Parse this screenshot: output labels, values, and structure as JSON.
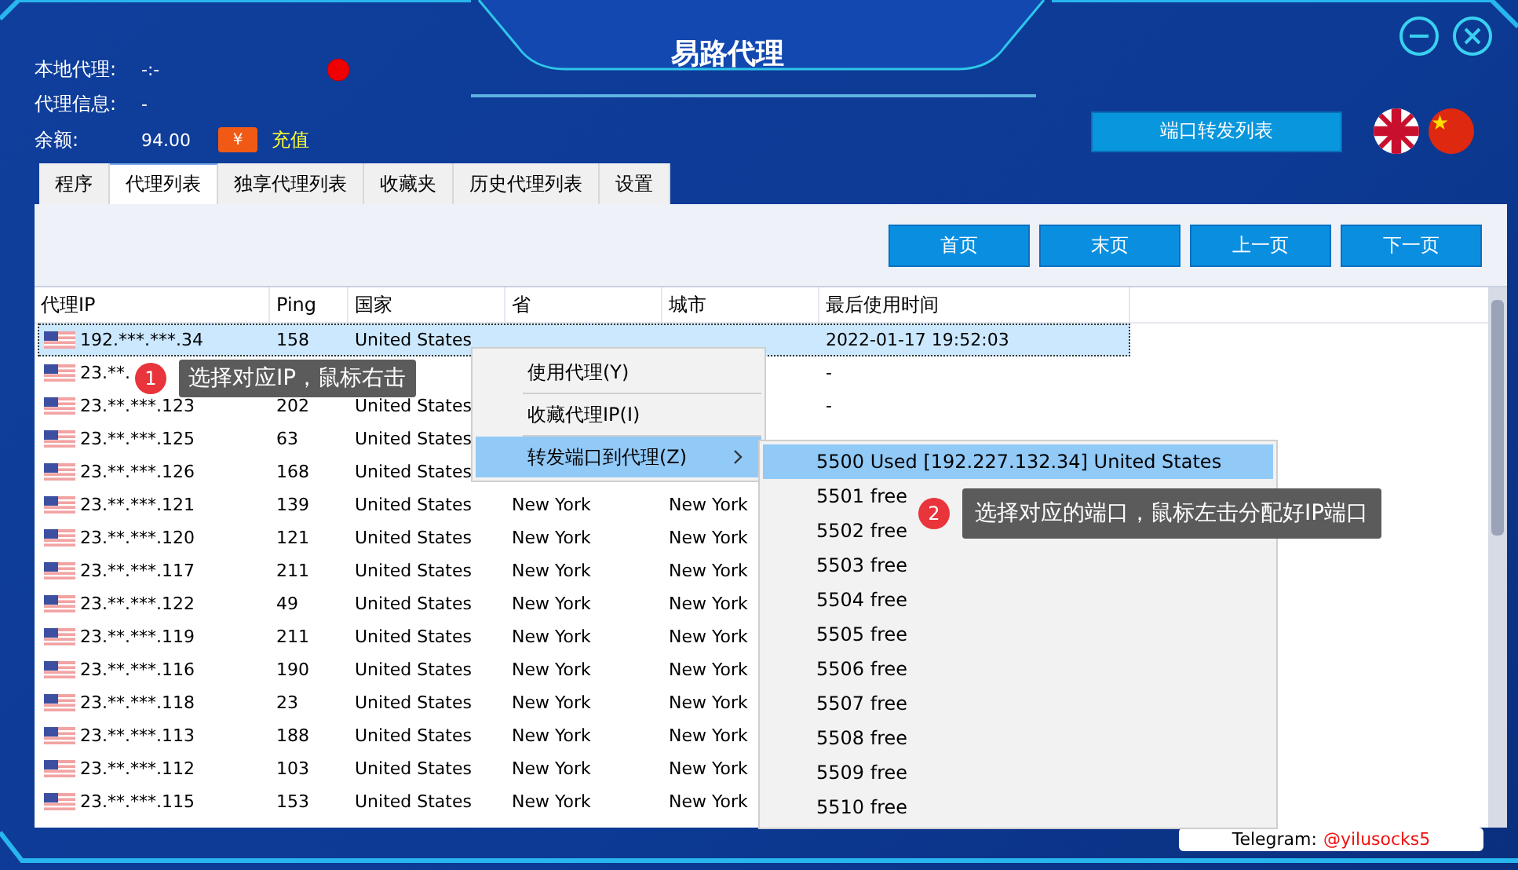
{
  "window": {
    "title": "易路代理"
  },
  "info": [
    {
      "label": "本地代理:",
      "value": "-:-"
    },
    {
      "label": "代理信息:",
      "value": "-"
    },
    {
      "label": "余额:",
      "value": "94.00"
    }
  ],
  "recharge": {
    "icon_text": "¥",
    "label": "充值"
  },
  "port_forward_button": "端口转发列表",
  "tabs": [
    {
      "label": "程序",
      "selected": false
    },
    {
      "label": "代理列表",
      "selected": true
    },
    {
      "label": "独享代理列表",
      "selected": false
    },
    {
      "label": "收藏夹",
      "selected": false
    },
    {
      "label": "历史代理列表",
      "selected": false
    },
    {
      "label": "设置",
      "selected": false
    }
  ],
  "pager": [
    "首页",
    "末页",
    "上一页",
    "下一页"
  ],
  "table": {
    "columns": [
      "代理IP",
      "Ping",
      "国家",
      "省",
      "城市",
      "最后使用时间"
    ],
    "rows": [
      {
        "ip": "192.***.***.34",
        "ping": "158",
        "country": "United States",
        "last_used": "2022-01-17 19:52:03",
        "selected": true
      },
      {
        "ip": "23.**.",
        "last_used": "-",
        "selected": false
      },
      {
        "ip": "23.**.***.123",
        "ping": "202",
        "country": "United States",
        "last_used": "-",
        "selected": false
      },
      {
        "ip": "23.**.***.125",
        "ping": "63",
        "country": "United States",
        "selected": false
      },
      {
        "ip": "23.**.***.126",
        "ping": "168",
        "country": "United States",
        "selected": false
      },
      {
        "ip": "23.**.***.121",
        "ping": "139",
        "country": "United States",
        "province": "New York",
        "city": "New York",
        "selected": false
      },
      {
        "ip": "23.**.***.120",
        "ping": "121",
        "country": "United States",
        "province": "New York",
        "city": "New York",
        "selected": false
      },
      {
        "ip": "23.**.***.117",
        "ping": "211",
        "country": "United States",
        "province": "New York",
        "city": "New York",
        "selected": false
      },
      {
        "ip": "23.**.***.122",
        "ping": "49",
        "country": "United States",
        "province": "New York",
        "city": "New York",
        "selected": false
      },
      {
        "ip": "23.**.***.119",
        "ping": "211",
        "country": "United States",
        "province": "New York",
        "city": "New York",
        "selected": false
      },
      {
        "ip": "23.**.***.116",
        "ping": "190",
        "country": "United States",
        "province": "New York",
        "city": "New York",
        "selected": false
      },
      {
        "ip": "23.**.***.118",
        "ping": "23",
        "country": "United States",
        "province": "New York",
        "city": "New York",
        "selected": false
      },
      {
        "ip": "23.**.***.113",
        "ping": "188",
        "country": "United States",
        "province": "New York",
        "city": "New York",
        "selected": false
      },
      {
        "ip": "23.**.***.112",
        "ping": "103",
        "country": "United States",
        "province": "New York",
        "city": "New York",
        "selected": false
      },
      {
        "ip": "23.**.***.115",
        "ping": "153",
        "country": "United States",
        "province": "New York",
        "city": "New York",
        "selected": false
      }
    ]
  },
  "context_menu": [
    {
      "label": "使用代理(Y)",
      "selected": false,
      "submenu": false
    },
    {
      "label": "收藏代理IP(I)",
      "selected": false,
      "submenu": false
    },
    {
      "label": "转发端口到代理(Z)",
      "selected": true,
      "submenu": true
    }
  ],
  "port_submenu": [
    {
      "label": "5500 Used [192.227.132.34] United States",
      "selected": true
    },
    {
      "label": "5501 free",
      "selected": false
    },
    {
      "label": "5502 free",
      "selected": false
    },
    {
      "label": "5503 free",
      "selected": false
    },
    {
      "label": "5504 free",
      "selected": false
    },
    {
      "label": "5505 free",
      "selected": false
    },
    {
      "label": "5506 free",
      "selected": false
    },
    {
      "label": "5507 free",
      "selected": false
    },
    {
      "label": "5508 free",
      "selected": false
    },
    {
      "label": "5509 free",
      "selected": false
    },
    {
      "label": "5510 free",
      "selected": false
    }
  ],
  "hints": [
    {
      "step": "1",
      "text": "选择对应IP，鼠标右击"
    },
    {
      "step": "2",
      "text": "选择对应的端口，鼠标左击分配好IP端口"
    }
  ],
  "footer": {
    "label": "Telegram:",
    "handle": "@yilusocks5"
  }
}
